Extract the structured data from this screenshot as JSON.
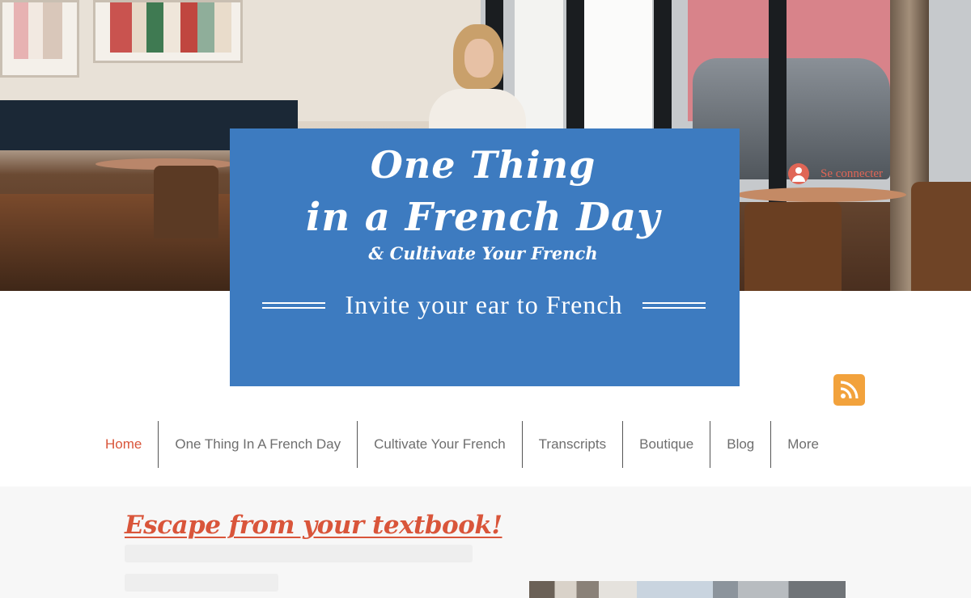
{
  "login": {
    "label": "Se connecter"
  },
  "header": {
    "title_line1": "One Thing",
    "title_line2": "in a French Day",
    "subtitle": "& Cultivate Your French",
    "tagline": "Invite your ear to French"
  },
  "social": {
    "rss_icon": "rss-icon",
    "rss_color": "#f2a23c"
  },
  "nav": {
    "items": [
      {
        "label": "Home",
        "active": true
      },
      {
        "label": "One Thing In A French Day"
      },
      {
        "label": "Cultivate Your French"
      },
      {
        "label": "Transcripts"
      },
      {
        "label": "Boutique"
      },
      {
        "label": "Blog"
      },
      {
        "label": "More"
      }
    ]
  },
  "content": {
    "heading": "Escape from your textbook!"
  },
  "colors": {
    "header_blue": "#3d7bc0",
    "accent": "#d9553a",
    "rss": "#f2a23c"
  }
}
